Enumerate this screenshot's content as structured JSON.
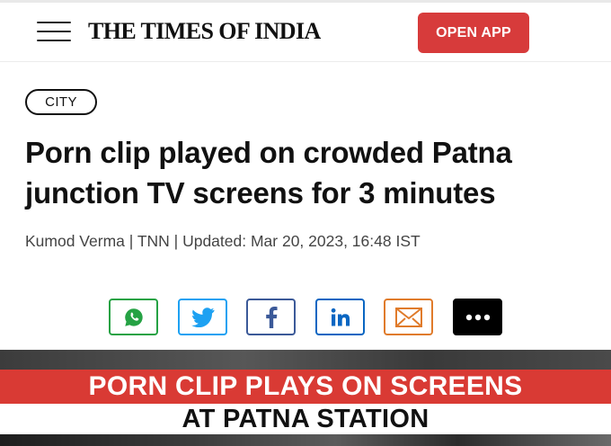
{
  "header": {
    "brand": "THE TIMES OF INDIA",
    "open_app_label": "OPEN APP",
    "open_app_color": "#d73b3b"
  },
  "article": {
    "category": "CITY",
    "headline": "Porn clip played on crowded Patna junction TV screens for 3 minutes",
    "byline": "Kumod Verma | TNN | Updated: Mar 20, 2023, 16:48 IST"
  },
  "share": [
    {
      "name": "whatsapp-icon",
      "color": "#25a244"
    },
    {
      "name": "twitter-icon",
      "color": "#1da1f2"
    },
    {
      "name": "facebook-icon",
      "color": "#3b5998"
    },
    {
      "name": "linkedin-icon",
      "color": "#0a66c2"
    },
    {
      "name": "email-icon",
      "color": "#e07b2b"
    },
    {
      "name": "more-icon",
      "color": "#000000"
    }
  ],
  "hero": {
    "banner_line1": "PORN CLIP PLAYS ON SCREENS",
    "banner_line2": "AT PATNA STATION",
    "banner_color": "#d93a34"
  }
}
